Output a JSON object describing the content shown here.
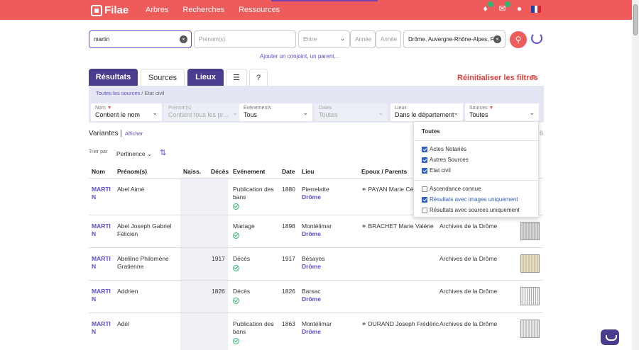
{
  "header": {
    "logo_text": "Filae",
    "nav": [
      "Arbres",
      "Recherches",
      "Ressources"
    ],
    "colors": {
      "brand": "#ef5a5a",
      "accent": "#4a3d8f",
      "link": "#5a4fcf"
    }
  },
  "search": {
    "name_value": "martin",
    "firstname_placeholder": "Prénom(s)",
    "event_value": "Entre",
    "year_from_placeholder": "Année",
    "year_to_placeholder": "Année",
    "place_value": "Drôme, Auvergne-Rhône-Alpes, Fra",
    "add_link": "Ajouter un conjoint, un parent..."
  },
  "tabs": {
    "results": "Résultats",
    "sources": "Sources",
    "places": "Lieux",
    "help": "?",
    "reset": "Réinitialiser les filtres"
  },
  "filters": {
    "breadcrumb_link": "Toutes les sources",
    "breadcrumb_sep": "/",
    "breadcrumb_current": "Etat civil",
    "nom_label": "Nom",
    "nom_value": "Contient le nom",
    "prenom_label": "Prénom(s)",
    "prenom_value": "Contient tous les pr...",
    "events_label": "Evénements",
    "events_value": "Tous",
    "dates_label": "Dates",
    "dates_value": "Toutes",
    "lieux_label": "Lieux",
    "lieux_value": "Dans le département",
    "sources_label": "Sources",
    "sources_value": "Toutes"
  },
  "variants": {
    "label": "Variantes",
    "link": "Afficher",
    "count_tail": "6"
  },
  "sort": {
    "label": "Trier par",
    "value": "Pertinence"
  },
  "table": {
    "headers": [
      "Nom",
      "Prénom(s)",
      "Naiss.",
      "Décès",
      "Evénement",
      "Date",
      "Lieu",
      "Epoux / Parents"
    ],
    "rows": [
      {
        "nom": "MARTIN",
        "prenom": "Abel Aimé",
        "deces": "",
        "event": "Publication des bans",
        "date": "1880",
        "lieu": "Pierrelatte",
        "dept": "Drôme",
        "parents": "PAYAN Marie Céci",
        "archive": ""
      },
      {
        "nom": "MARTIN",
        "prenom": "Abel Joseph Gabriel Félicien",
        "deces": "",
        "event": "Mariage",
        "date": "1898",
        "lieu": "Montélimar",
        "dept": "Drôme",
        "parents": "BRACHET Marie Valérie",
        "archive": "Archives de la Drôme"
      },
      {
        "nom": "MARTIN",
        "prenom": "Abelline Philomène Gratienne",
        "deces": "1917",
        "event": "Décès",
        "date": "1917",
        "lieu": "Bésayes",
        "dept": "Drôme",
        "parents": "",
        "archive": "Archives de la Drôme"
      },
      {
        "nom": "MARTIN",
        "prenom": "Addrien",
        "deces": "1826",
        "event": "Décès",
        "date": "1826",
        "lieu": "Barsac",
        "dept": "Drôme",
        "parents": "",
        "archive": "Archives de la Drôme"
      },
      {
        "nom": "MARTIN",
        "prenom": "Adèl",
        "deces": "",
        "event": "Publication des bans",
        "date": "1863",
        "lieu": "Montélimar",
        "dept": "Drôme",
        "parents": "DURAND Joseph Frédéric",
        "archive": "Archives de la Drôme"
      }
    ]
  },
  "sources_dropdown": {
    "title": "Toutes",
    "options": [
      {
        "label": "Actes Notariés",
        "checked": true
      },
      {
        "label": "Autres Sources",
        "checked": true
      },
      {
        "label": "Etat civil",
        "checked": true
      }
    ],
    "extra": [
      {
        "label": "Ascendance connue",
        "checked": false
      },
      {
        "label": "Résultats avec images uniquement",
        "checked": true
      },
      {
        "label": "Résultats avec sources uniquement",
        "checked": false
      }
    ]
  }
}
